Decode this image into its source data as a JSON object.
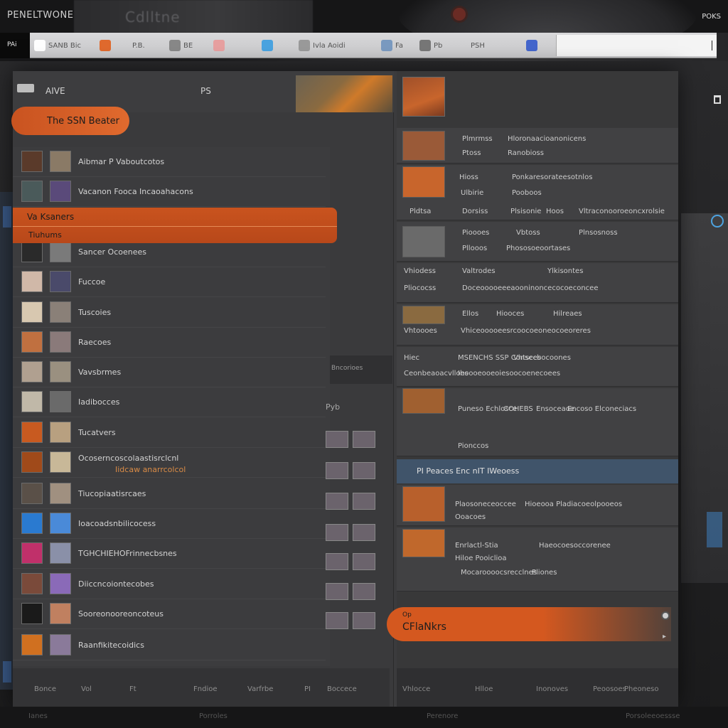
{
  "titlebar": {
    "app_name": "PENELTWONE",
    "tab_text": "Cdlltne",
    "right_label": "POKS"
  },
  "toolbar": {
    "corner_label": "PAi",
    "tools": [
      {
        "label": "SANB Bic",
        "icon": "pencil-icon",
        "color": "#ffffff"
      },
      {
        "label": "",
        "icon": "record-icon",
        "color": "#e06a2e"
      },
      {
        "label": "P.B.",
        "icon": "",
        "color": ""
      },
      {
        "label": "BE",
        "icon": "brush-icon",
        "color": "#888888"
      },
      {
        "label": "",
        "icon": "image-icon",
        "color": "#e7a0a0"
      },
      {
        "label": "",
        "icon": "cloud-icon",
        "color": "#4aa3e0"
      },
      {
        "label": "Ivla Aoidi",
        "icon": "droplet-icon",
        "color": "#9a9a9a"
      },
      {
        "label": "Fa",
        "icon": "stack-icon",
        "color": "#7a9ac0"
      },
      {
        "label": "Pb",
        "icon": "pen-icon",
        "color": "#777777"
      },
      {
        "label": "PSH",
        "icon": "",
        "color": ""
      },
      {
        "label": "",
        "icon": "flag-icon",
        "color": "#4466cc"
      }
    ]
  },
  "left_header": {
    "title": "AIVE",
    "subtitle": "PS"
  },
  "new_folder_button": "The SSN Beater",
  "selected_item": {
    "line1": "Va Ksaners",
    "line2": "Tiuhums"
  },
  "list_items": [
    {
      "label": "Aibmar P Vaboutcotos",
      "c1": "#5a3a2a",
      "c2": "#8a7a66"
    },
    {
      "label": "Vacanon Fooca Incaoahacons",
      "c1": "#4a5a5a",
      "c2": "#5a4a7a"
    },
    {
      "label": "Sancer Ocoenees",
      "c1": "#2a2a2a",
      "c2": "#7a7a7a"
    },
    {
      "label": "Fuccoe",
      "c1": "#d0b8a8",
      "c2": "#4a4a6a"
    },
    {
      "label": "Tuscoies",
      "c1": "#d8c8b0",
      "c2": "#8a8078"
    },
    {
      "label": "Raecoes",
      "c1": "#c07040",
      "c2": "#8a7a7a"
    },
    {
      "label": "Vavsbrmes",
      "c1": "#b0a090",
      "c2": "#9a9080"
    },
    {
      "label": "Iadibocces",
      "c1": "#c0b8a8",
      "c2": "#6a6a6a"
    },
    {
      "label": "Tucatvers",
      "c1": "#c85a20",
      "c2": "#b8a080"
    },
    {
      "label": "Ocoserncoscolaastisrclcnl",
      "label2": "Iidcaw anarrcolcol",
      "c1": "#a04a1a",
      "c2": "#c8b898"
    },
    {
      "label": "Tiucopiaatisrcaes",
      "c1": "#5a5048",
      "c2": "#a09080"
    },
    {
      "label": "Ioacoadsnbilicocess",
      "c1": "#2a7ad0",
      "c2": "#4a8ad8"
    },
    {
      "label": "TGHCHIEHOFrinnecbsnes",
      "c1": "#c0306a",
      "c2": "#8a90a8"
    },
    {
      "label": "Diiccncoiontecobes",
      "c1": "#7a4a3a",
      "c2": "#8a6ab8"
    },
    {
      "label": "Sooreonooreoncoteus",
      "c1": "#1a1a1a",
      "c2": "#c08060"
    },
    {
      "label": "Raanfikitecoidics",
      "c1": "#d07020",
      "c2": "#8a7a9a"
    }
  ],
  "middle": {
    "strip_label": "Bncorioes",
    "label": "Pyb"
  },
  "left_footer": [
    "Bonce",
    "Vol",
    "Ft",
    "Fndioe",
    "Varfrbe",
    "PI",
    "Boccece"
  ],
  "right_cards": [
    {
      "lines": [
        "Plmrmss",
        "Hloronaacioanonicens",
        "Ptoss",
        "Ranobioss"
      ]
    },
    {
      "lines": [
        "Hioss",
        "Ponkaresorateesotnlos",
        "Ulbirie",
        "Pooboos",
        "Pldtsa",
        "Dorsiss",
        "Plsisonie",
        "Hoos",
        "Vltraconooroeoncxrolsie"
      ]
    },
    {
      "lines": [
        "Pioooes",
        "Vbtoss",
        "Plnsosnoss",
        "Pllooos",
        "Phososoeoortases"
      ]
    },
    {
      "lines": [
        "Vhiodess",
        "Valtrodes",
        "Ylkisontes",
        "Pliococss",
        "Doceooooeeeaooninoncecocoeconcee"
      ]
    },
    {
      "lines": [
        "Ellos",
        "Hiooces",
        "Hilreaes",
        "Vhtoooes",
        "Vhiceooooeesrcoocoeoneocoeoreres"
      ]
    },
    {
      "lines": [
        "Hiec",
        "MSENCHS SSP Consecbocoones",
        "Vhtsces",
        "Ceonbeaoacvlloes",
        "Ihoooeooeoiesoocoenecoees"
      ]
    },
    {
      "lines": [
        "Puneso Echlosce",
        "COHEBS",
        "Ensoceaoe",
        "Encoso Elconeciacs",
        "Pionccos"
      ]
    }
  ],
  "right_section": "PI Peaces Enc nIT IWeoess",
  "right_lower_cards": [
    {
      "lines": [
        "Plaosoneceoccee",
        "Hioeooa Pladiacoeolpooeos",
        "Ooacoes"
      ]
    },
    {
      "lines": [
        "Enrlactl-Stia",
        "Haeocoesoccorenee",
        "Hiloe Pooiclioa",
        "Mocaroooocsrecclnes",
        "Pliones"
      ]
    }
  ],
  "cta": {
    "line1": "Op",
    "line2": "CFlaNkrs"
  },
  "right_footer": [
    "Vhlocce",
    "Hlloe",
    "Inonoves",
    "Peoosoes",
    "Pheoneso"
  ],
  "bottom_strip": [
    "Ianes",
    "Porroles",
    "Perenore",
    "Porsoleeoessse"
  ]
}
